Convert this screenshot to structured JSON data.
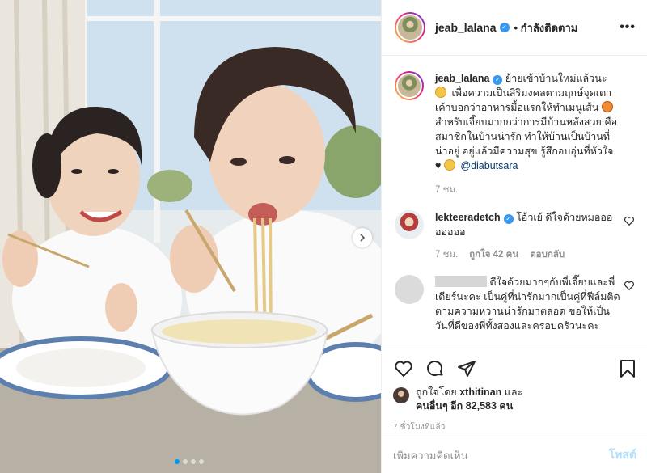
{
  "header": {
    "username": "jeab_lalana",
    "follow_status": "• กำลังติดตาม",
    "more_label": "•••"
  },
  "caption": {
    "username": "jeab_lalana",
    "text_1": "ย้ายเข้าบ้านใหม่แล้วนะ",
    "text_2": "เพื่อความเป็นสิริมงคลตามฤกษ์จุดเตา เค้าบอกว่าอาหารมื้อแรกให้ทำเมนูเส้น",
    "text_3": "สำหรับเจี๊ยบมากกว่าการมีบ้านหลังสวย คือสมาชิกในบ้านน่ารัก ทำให้บ้านเป็นบ้านที่น่าอยู่ อยู่แล้วมีความสุข รู้สึกอบอุ่นที่หัวใจ",
    "heart": "♥",
    "mention": "@diabutsara",
    "time": "7 ชม."
  },
  "comments": [
    {
      "username": "lekteeradetch",
      "text": "โอ้วเย้ ดีใจด้วยหมออออออออ",
      "time": "7 ชม.",
      "likes": "ถูกใจ 42 คน",
      "reply": "ตอบกลับ"
    },
    {
      "text": "ดีใจด้วยมากๆกับพี่เจี๊ยบและพี่เดียร์นะคะ เป็นคู่ที่น่ารักมากเป็นคู่ที่ฟีล์มติดตามความหวานน่ารักมาตลอด ขอให้เป็นวันที่ดีของพี่ทั้งสองและครอบครัวนะคะ"
    }
  ],
  "likes": {
    "liked_by_prefix": "ถูกใจโดย ",
    "liked_by_user": "xthitinan",
    "and": " และ",
    "others": "คนอื่นๆ อีก 82,583 คน"
  },
  "timestamp": "7 ชั่วโมงที่แล้ว",
  "add_comment": {
    "placeholder": "เพิ่มความคิดเห็น",
    "post_label": "โพสต์"
  },
  "carousel": {
    "total_slides": 4,
    "active_slide": 1
  },
  "icons": {
    "like": "heart-icon",
    "comment": "comment-icon",
    "share": "share-icon",
    "save": "bookmark-icon",
    "next": "chevron-right-icon",
    "verified": "verified-badge-icon"
  }
}
